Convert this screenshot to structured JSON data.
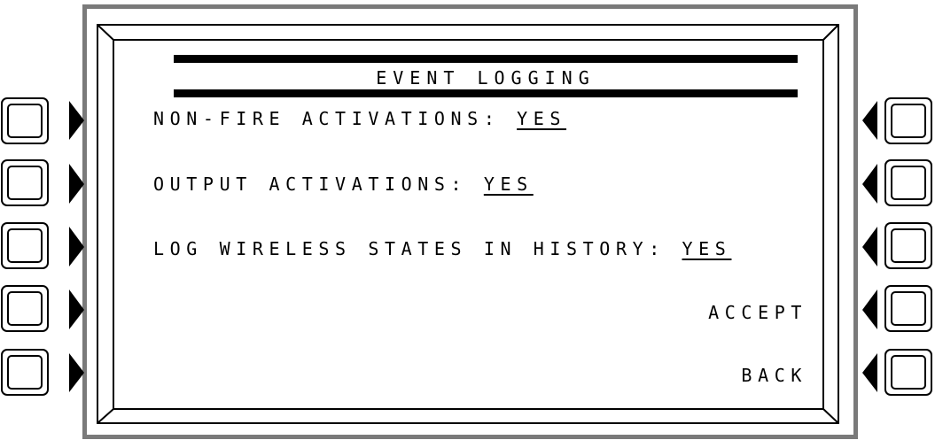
{
  "screen": {
    "title": "EVENT LOGGING",
    "options": [
      {
        "label": "NON-FIRE ACTIVATIONS: ",
        "value": "YES"
      },
      {
        "label": "OUTPUT ACTIVATIONS: ",
        "value": "YES"
      },
      {
        "label": "LOG WIRELESS STATES IN HISTORY: ",
        "value": "YES"
      }
    ],
    "accept_label": "ACCEPT",
    "back_label": "BACK"
  },
  "colors": {
    "frame": "#7a7a7a",
    "text": "#000000",
    "background": "#ffffff"
  }
}
